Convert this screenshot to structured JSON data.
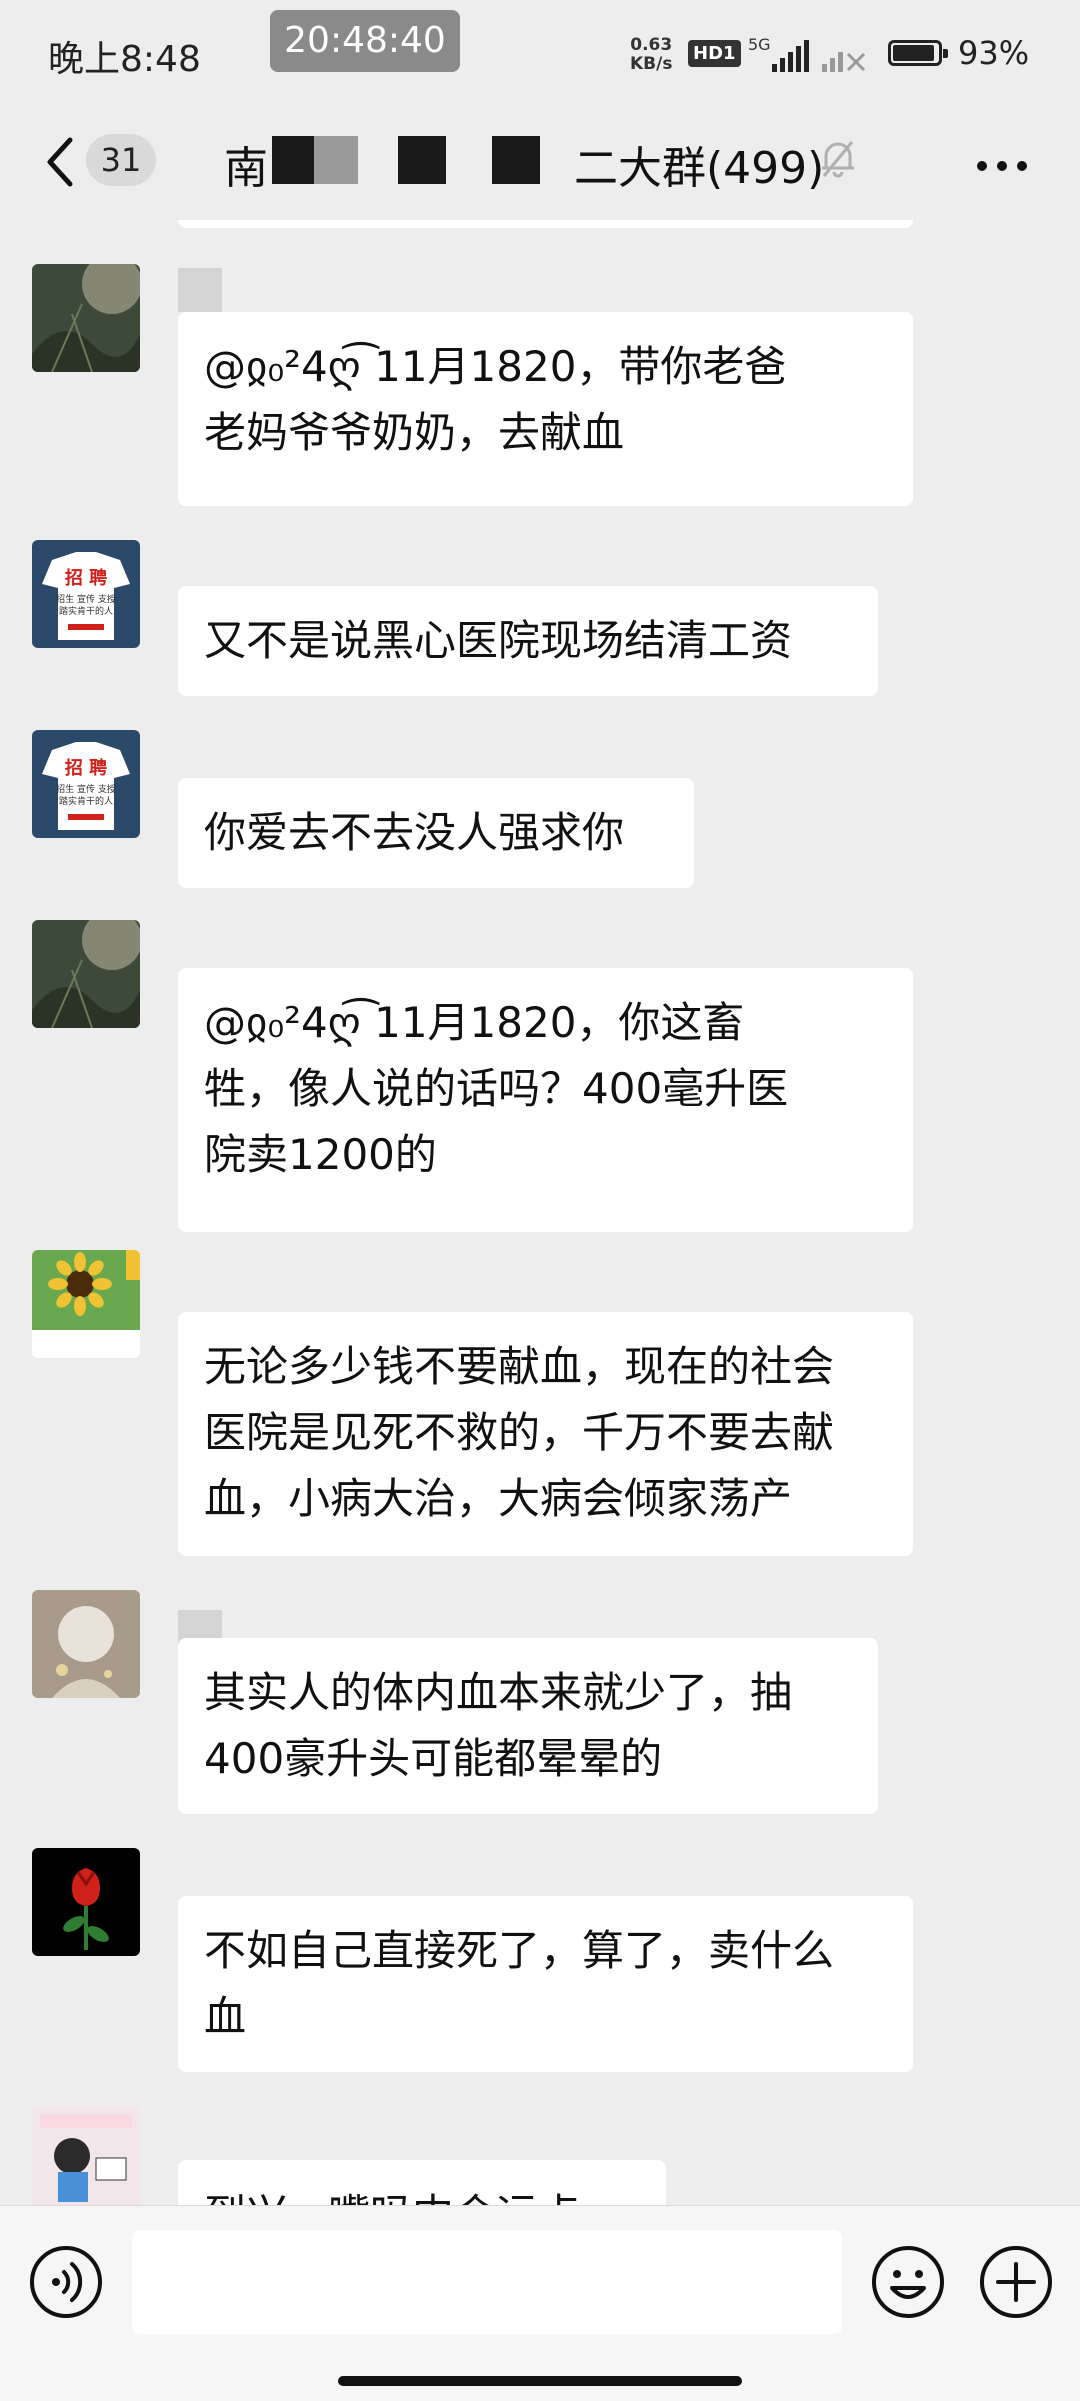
{
  "status_bar": {
    "time": "晚上8:48",
    "recording_timer": "20:48:40",
    "net_speed_value": "0.63",
    "net_speed_unit": "KB/s",
    "hd_label": "HD1",
    "network_label": "5G",
    "battery": "93%",
    "battery_level": 0.93
  },
  "header": {
    "unread_count": "31",
    "title_start": "南",
    "title_end": "二大群(499)",
    "icons": [
      "back-icon",
      "mute-bell-icon",
      "more-icon"
    ]
  },
  "messages": [
    {
      "text_lines": [
        "@ჲ₀²4ღ͡ 11月1820，带你老爸",
        "老妈爷爷奶奶，去献血"
      ]
    },
    {
      "text_lines": [
        "又不是说黑心医院现场结清工资"
      ]
    },
    {
      "text_lines": [
        "你爱去不去没人强求你"
      ]
    },
    {
      "text_lines": [
        "@ჲ₀²4ღ͡ 11月1820，你这畜",
        "牲，像人说的话吗？400毫升医",
        "院卖1200的"
      ]
    },
    {
      "text_lines": [
        "无论多少钱不要献血，现在的社会",
        "医院是见死不救的，千万不要去献",
        "血，小病大治，大病会倾家荡产"
      ]
    },
    {
      "text_lines": [
        "其实人的体内血本来就少了，抽",
        "400豪升头可能都晕晕的"
      ]
    },
    {
      "text_lines": [
        "不如自己直接死了，算了，卖什么",
        "血"
      ]
    },
    {
      "text_lines": [
        "到兴...嘴吗中会运点"
      ]
    }
  ],
  "avatar_texts": {
    "poster_title": "招 聘",
    "poster_sub": "招生 宣传 支授",
    "poster_sub2": "踏实肯干的人"
  },
  "input": {
    "placeholder": "",
    "value": ""
  },
  "colors": {
    "background": "#ededed",
    "bubble": "#ffffff",
    "accent": "#07c160"
  }
}
